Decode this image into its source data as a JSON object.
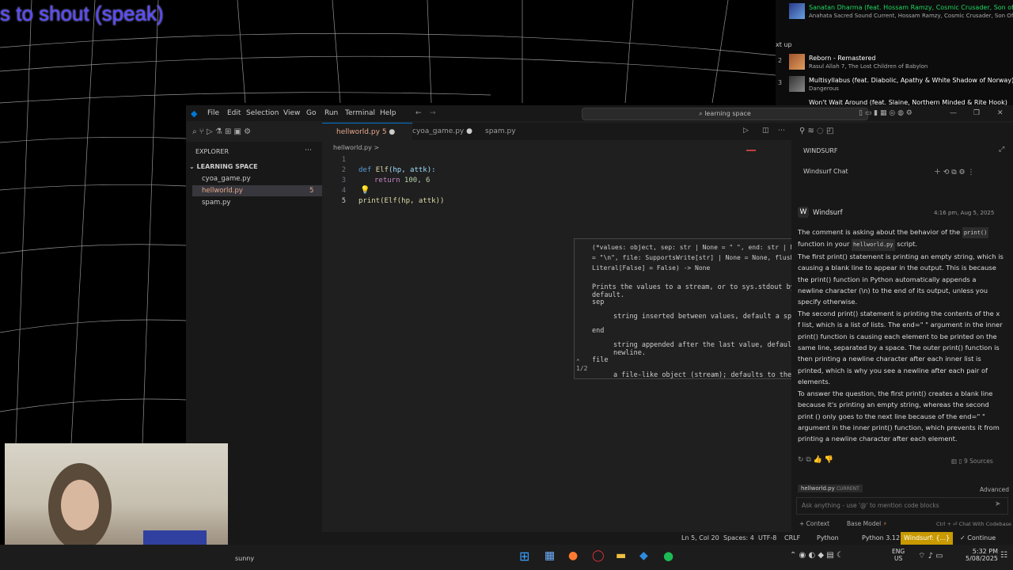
{
  "overlay": {
    "text": "s to shout (speak)"
  },
  "music": {
    "now_playing": {
      "title": "Sanatan Dharma (feat. Hossam Ramzy, Cosmic Crusader, Son of Saturn,",
      "subtitle": "Anahata Sacred Sound Current, Hossam Ramzy, Cosmic Crusader, Son Of Saturn,"
    },
    "next_up_label": "xt up",
    "tracks": [
      {
        "num": "2",
        "title": "Reborn - Remastered",
        "subtitle": "Rasul Allah 7, The Lost Children of Babylon"
      },
      {
        "num": "3",
        "title": "Multisyllabus (feat. Diabolic, Apathy & White Shadow of Norway)",
        "subtitle": "Dangerous"
      },
      {
        "num": "",
        "title": "Won't Wait Around (feat. Slaine, Northern Minded & Rite Hook)",
        "subtitle": ""
      }
    ]
  },
  "titlebar": {
    "menus": [
      "File",
      "Edit",
      "Selection",
      "View",
      "Go",
      "Run",
      "Terminal",
      "Help"
    ],
    "search": "learning space"
  },
  "explorer": {
    "header": "EXPLORER",
    "folder": "LEARNING SPACE",
    "files": [
      {
        "name": "cyoa_game.py",
        "badge": ""
      },
      {
        "name": "hellworld.py",
        "badge": "5"
      },
      {
        "name": "spam.py",
        "badge": ""
      }
    ]
  },
  "tabs": [
    {
      "name": "hellworld.py",
      "badge": "5"
    },
    {
      "name": "cyoa_game.py",
      "badge": ""
    },
    {
      "name": "spam.py",
      "badge": ""
    }
  ],
  "breadcrumb": "hellworld.py >",
  "code": {
    "line_numbers": [
      "1",
      "2",
      "3",
      "4",
      "5"
    ],
    "l2": {
      "kw": "def",
      "fn": "Elf",
      "rest": "(hp, attk):"
    },
    "l3": {
      "kw": "return",
      "rest": " 100, 6"
    },
    "l5": "print(Elf(hp, attk))"
  },
  "hover": {
    "signature": "(*values: object, sep: str | None = \" \", end: str | None = \"\\n\", file: SupportsWrite[str] | None = None, flush: Literal[False] = False) -> None",
    "desc": "Prints the values to a stream, or to sys.stdout by default.",
    "params": [
      {
        "name": "sep",
        "desc": "string inserted between values, default a space."
      },
      {
        "name": "end",
        "desc": "string appended after the last value, default a newline."
      },
      {
        "name": "file",
        "desc": "a file-like object (stream); defaults to the current"
      }
    ],
    "pager": "1/2"
  },
  "windsurf": {
    "title": "WINDSURF",
    "chat_tab": "Windsurf Chat",
    "author": "Windsurf",
    "timestamp": "4:16 pm, Aug 5, 2025",
    "sources": "9 Sources",
    "context_file": "hellworld.py",
    "context_tag": "CURRENT",
    "advanced": "Advanced",
    "input_placeholder": "Ask anything - use '@' to mention code blocks",
    "context_btn": "Context",
    "model_btn": "Base Model",
    "shortcut_hint": "Ctrl + ⏎  Chat With Codebase",
    "p1_a": "The comment is asking about the behavior of the",
    "p1_code": "print()",
    "p1_b": "function in your",
    "p1_code2": "hellworld.py",
    "p1_c": "script.",
    "p2": "The first print() statement is printing an empty string, which is causing a blank line to appear in the output. This is because the print() function in Python automatically appends a newline character (\\n) to the end of its output, unless you specify otherwise.",
    "p3": "The second print() statement is printing the contents of the x f list, which is a list of lists. The end=\" \" argument in the inner print() function is causing each element to be printed on the same line, separated by a space. The outer print() function is then printing a newline character after each inner list is printed, which is why you see a newline after each pair of elements.",
    "p4": "To answer the question, the first print() creates a blank line because it's printing an empty string, whereas the second print () only goes to the next line because of the end=\" \" argument in the inner print() function, which prevents it from printing a newline character after each element."
  },
  "status": {
    "position": "Ln 5, Col 20",
    "spaces": "Spaces: 4",
    "encoding": "UTF-8",
    "eol": "CRLF",
    "language": "Python",
    "python_version": "Python 3.12",
    "windsurf": "Windsurf: {...}",
    "continue": "Continue"
  },
  "taskbar": {
    "weather": "sunny",
    "lang1": "ENG",
    "lang2": "US",
    "time": "5:32 PM",
    "date": "5/08/2025"
  },
  "colors": {
    "accent": "#0078d4",
    "modified": "#e8a88c",
    "spotify": "#1db954",
    "windsurf_badge": "#c89a00"
  }
}
